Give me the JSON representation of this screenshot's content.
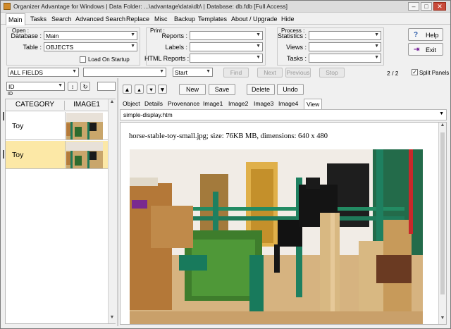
{
  "window": {
    "title": "Organizer Advantage for Windows | Data Folder: ...\\advantage\\data\\db\\ | Database: db.fdb [Full Access]",
    "controls": {
      "minimize": "–",
      "maximize": "□",
      "close": "✕"
    }
  },
  "menu": [
    "Main",
    "Tasks",
    "Search",
    "Advanced Search",
    "Replace",
    "Misc",
    "Backup",
    "Templates",
    "About / Upgrade",
    "Hide"
  ],
  "open_group": {
    "title": "Open :",
    "database_label": "Database :",
    "database_value": "Main",
    "table_label": "Table :",
    "table_value": "OBJECTS",
    "load_on_startup": "Load On Startup"
  },
  "print_group": {
    "title": "Print :",
    "reports_label": "Reports :",
    "labels_label": "Labels :",
    "html_reports_label": "HTML Reports :"
  },
  "process_group": {
    "title": "Process :",
    "statistics_label": "Statistics :",
    "views_label": "Views :",
    "tasks_label": "Tasks :"
  },
  "buttons": {
    "help": "Help",
    "exit": "Exit"
  },
  "search_bar": {
    "field": "ALL FIELDS",
    "mode": "Start",
    "find": "Find",
    "next": "Next",
    "previous": "Previous",
    "stop": "Stop",
    "counter": "2 / 2",
    "split_panels": "Split Panels"
  },
  "left_panel": {
    "sort_field": "ID",
    "sort_caption": "ID",
    "columns": [
      "CATEGORY",
      "IMAGE1"
    ],
    "rows": [
      {
        "category": "Toy"
      },
      {
        "category": "Toy"
      }
    ]
  },
  "record_toolbar": {
    "new": "New",
    "save": "Save",
    "delete": "Delete",
    "undo": "Undo"
  },
  "tabs": [
    "Object",
    "Details",
    "Provenance",
    "Image1",
    "Image2",
    "Image3",
    "Image4",
    "View"
  ],
  "view": {
    "template": "simple-display.htm",
    "image_info": "horse-stable-toy-small.jpg; size: 76KB MB, dimensions: 640 x 480"
  },
  "colors": {
    "selected_row": "#fce8a6",
    "accent": "#3a72b8"
  },
  "icons": {
    "nav": [
      "first-record-icon",
      "previous-record-icon",
      "next-record-icon",
      "last-record-icon"
    ],
    "refresh": "refresh-icon",
    "sort": "sort-toggle-icon"
  }
}
